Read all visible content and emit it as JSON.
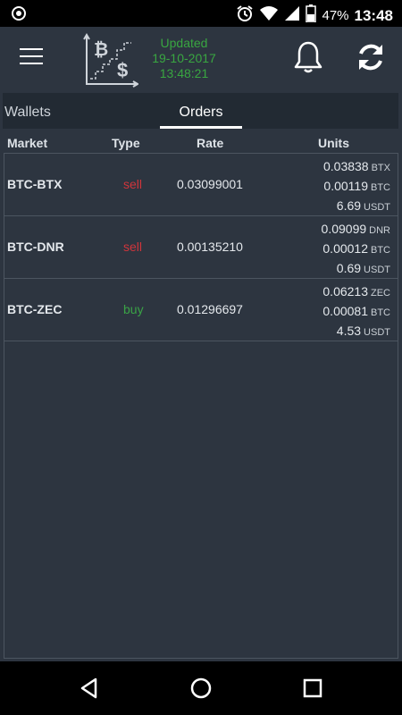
{
  "status_bar": {
    "battery_percent": "47%",
    "time": "13:48",
    "icons": [
      "record-icon",
      "alarm-icon",
      "wifi-icon",
      "signal-icon",
      "battery-icon"
    ]
  },
  "app_bar": {
    "updated_label": "Updated",
    "updated_date": "19-10-2017",
    "updated_time": "13:48:21",
    "colors": {
      "updated_text": "#39a641",
      "background": "#2d3540"
    }
  },
  "tabs": [
    {
      "label": "Wallets",
      "selected": false
    },
    {
      "label": "Orders",
      "selected": true
    }
  ],
  "table": {
    "headers": {
      "market": "Market",
      "type": "Type",
      "rate": "Rate",
      "units": "Units"
    },
    "rows": [
      {
        "market": "BTC-BTX",
        "type": "sell",
        "rate": "0.03099001",
        "units": [
          {
            "amount": "0.03838",
            "currency": "BTX"
          },
          {
            "amount": "0.00119",
            "currency": "BTC"
          },
          {
            "amount": "6.69",
            "currency": "USDT"
          }
        ]
      },
      {
        "market": "BTC-DNR",
        "type": "sell",
        "rate": "0.00135210",
        "units": [
          {
            "amount": "0.09099",
            "currency": "DNR"
          },
          {
            "amount": "0.00012",
            "currency": "BTC"
          },
          {
            "amount": "0.69",
            "currency": "USDT"
          }
        ]
      },
      {
        "market": "BTC-ZEC",
        "type": "buy",
        "rate": "0.01296697",
        "units": [
          {
            "amount": "0.06213",
            "currency": "ZEC"
          },
          {
            "amount": "0.00081",
            "currency": "BTC"
          },
          {
            "amount": "4.53",
            "currency": "USDT"
          }
        ]
      }
    ],
    "colors": {
      "sell": "#d0353b",
      "buy": "#3aa346"
    }
  }
}
